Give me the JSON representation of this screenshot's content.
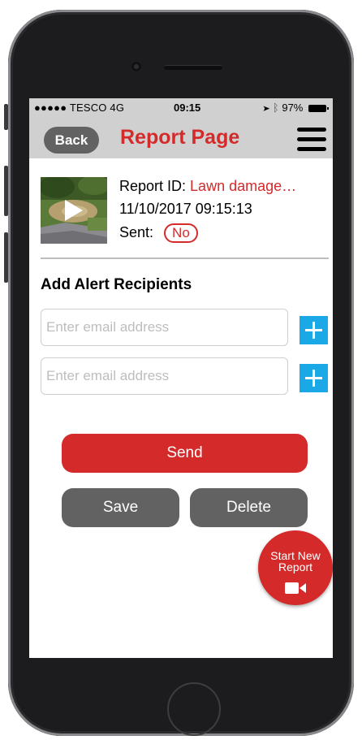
{
  "status_bar": {
    "carrier": "●●●●● TESCO  4G",
    "time": "09:15",
    "battery": "97%"
  },
  "nav": {
    "back_label": "Back",
    "title": "Report Page"
  },
  "report": {
    "id_label": "Report ID:",
    "id_value": "Lawn damage…",
    "datetime": "11/10/2017 09:15:13",
    "sent_label": "Sent:",
    "sent_value": "No"
  },
  "recipients": {
    "section_title": "Add Alert Recipients",
    "email_placeholder": "Enter email address"
  },
  "actions": {
    "send_label": "Send",
    "save_label": "Save",
    "delete_label": "Delete"
  },
  "fab": {
    "line1": "Start New",
    "line2": "Report"
  },
  "colors": {
    "accent_red": "#d42a2a",
    "add_button_blue": "#1aa8e6",
    "button_grey": "#626262",
    "bar_grey": "#d0d0d0"
  }
}
